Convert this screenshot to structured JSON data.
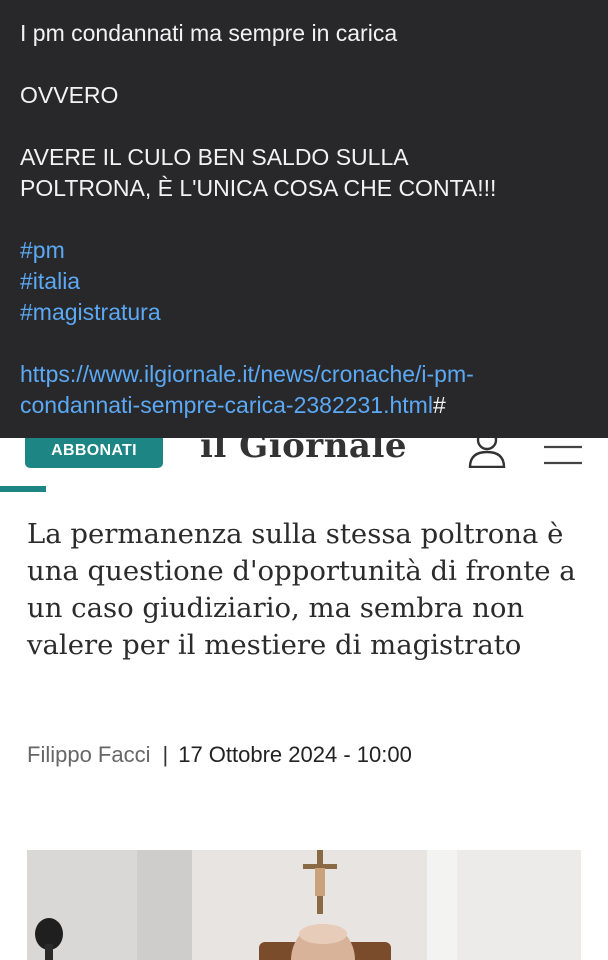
{
  "post": {
    "line1": "I pm condannati ma sempre in carica",
    "line2": "OVVERO",
    "line3": "AVERE IL CULO BEN SALDO SULLA",
    "line4": "POLTRONA, È L'UNICA COSA CHE CONTA!!!",
    "hashtags": [
      "#pm",
      "#italia",
      "#magistratura"
    ],
    "url_part1": "https://www.ilgiornale.it/news/cronache/i-pm-",
    "url_part2": "condannati-sempre-carica-2382231.html",
    "url_suffix": "#"
  },
  "site": {
    "subscribe_label": "ABBONATI",
    "logo_text": "il Giornale",
    "headline": "La permanenza sulla stessa poltrona è una questione d'opportunità di fronte a un caso giudiziario, ma sembra non valere per il mestiere di magistrato",
    "author": "Filippo Facci",
    "separator": "|",
    "date": "17 Ottobre 2024 - 10:00",
    "icons": {
      "user": "user-icon",
      "menu": "hamburger-menu-icon"
    },
    "colors": {
      "accent": "#1d8584",
      "post_bg": "#28282a",
      "link": "#5ba9f5"
    }
  }
}
